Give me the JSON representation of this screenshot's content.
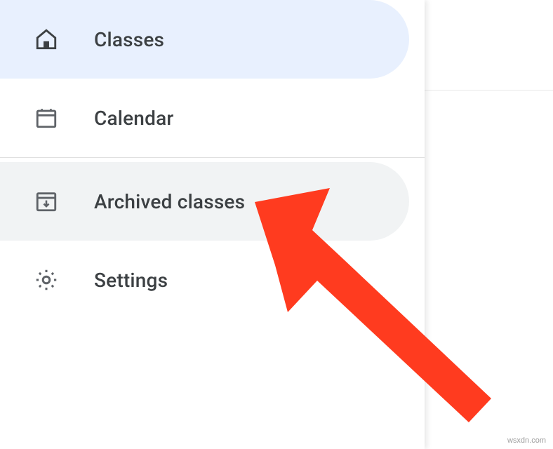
{
  "sidebar": {
    "items": [
      {
        "label": "Classes"
      },
      {
        "label": "Calendar"
      },
      {
        "label": "Archived classes"
      },
      {
        "label": "Settings"
      }
    ]
  },
  "watermark": "wsxdn.com"
}
